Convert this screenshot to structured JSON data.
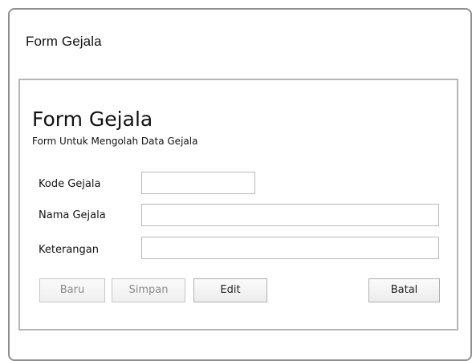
{
  "window": {
    "title": "Form Gejala"
  },
  "form": {
    "title": "Form Gejala",
    "subtitle": "Form Untuk Mengolah Data Gejala",
    "fields": {
      "kode_gejala": {
        "label": "Kode Gejala",
        "value": ""
      },
      "nama_gejala": {
        "label": "Nama Gejala",
        "value": ""
      },
      "keterangan": {
        "label": "Keterangan",
        "value": ""
      }
    },
    "buttons": {
      "baru": "Baru",
      "simpan": "Simpan",
      "edit": "Edit",
      "batal": "Batal"
    }
  }
}
